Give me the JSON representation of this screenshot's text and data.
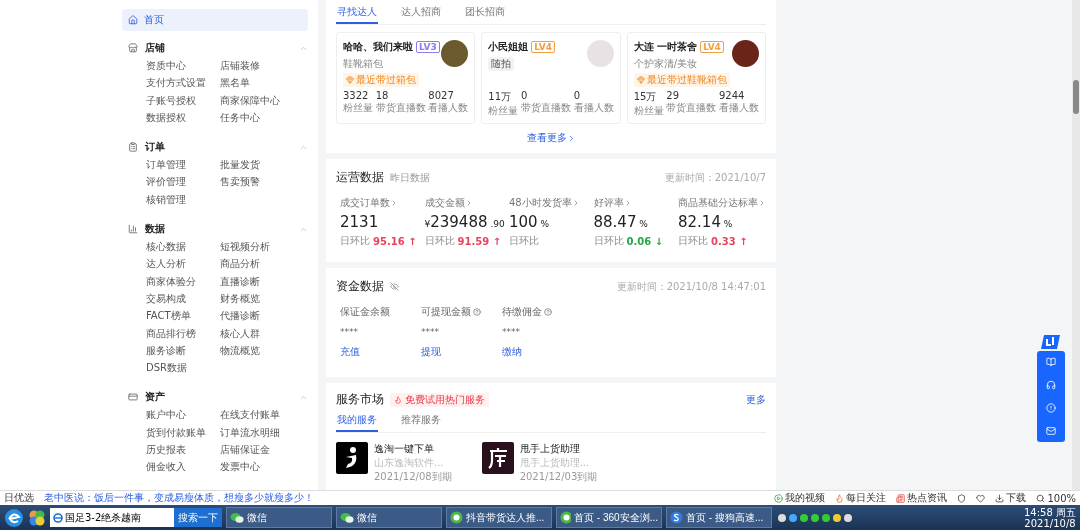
{
  "sidebar": {
    "home": {
      "label": "首页",
      "selected": true
    },
    "sections": [
      {
        "kind": "store",
        "title": "店铺",
        "expanded": true,
        "items": [
          "资质中心",
          "店铺装修",
          "支付方式设置",
          "黑名单",
          "子账号授权",
          "商家保障中心",
          "数据授权",
          "任务中心"
        ]
      },
      {
        "kind": "order",
        "title": "订单",
        "expanded": true,
        "items": [
          "订单管理",
          "批量发货",
          "评价管理",
          "售卖预警",
          "核销管理"
        ]
      },
      {
        "kind": "data",
        "title": "数据",
        "expanded": true,
        "items": [
          "核心数据",
          "短视频分析",
          "达人分析",
          "商品分析",
          "商家体验分",
          "直播诊断",
          "交易构成",
          "财务概览",
          "FACT榜单",
          "代播诊断",
          "商品排行榜",
          "核心人群",
          "服务诊断",
          "物流概览",
          "DSR数据"
        ]
      },
      {
        "kind": "asset",
        "title": "资产",
        "expanded": true,
        "items": [
          "账户中心",
          "在线支付账单",
          "货到付款账单",
          "订单流水明细",
          "历史报表",
          "店铺保证金",
          "佣金收入",
          "发票中心"
        ]
      }
    ]
  },
  "influencers": {
    "tabs": [
      {
        "label": "寻找达人",
        "selected": true
      },
      {
        "label": "达人招商",
        "selected": false
      },
      {
        "label": "团长招商",
        "selected": false
      }
    ],
    "cards": [
      {
        "name": "哈哈、我们来啦",
        "level": "LV3",
        "color": "#8a7df0",
        "category": "鞋靴箱包",
        "category_boxed": false,
        "badge": "最近带过箱包",
        "stats": [
          {
            "value": "3322",
            "label": "粉丝量"
          },
          {
            "value": "18",
            "label": "带货直播数"
          },
          {
            "value": "8027",
            "label": "看播人数"
          }
        ]
      },
      {
        "name": "小民姐姐",
        "level": "LV4",
        "color": "#f0a040",
        "category": "随拍",
        "category_boxed": true,
        "stats": [
          {
            "value": "11万",
            "label": "粉丝量"
          },
          {
            "value": "0",
            "label": "带货直播数"
          },
          {
            "value": "0",
            "label": "看播人数"
          }
        ]
      },
      {
        "name": "大连 一时茶舍",
        "level": "LV4",
        "color": "#f0a040",
        "category": "个护家清/美妆",
        "category_boxed": false,
        "badge": "最近带过鞋靴箱包",
        "stats": [
          {
            "value": "15万",
            "label": "粉丝量"
          },
          {
            "value": "29",
            "label": "带货直播数"
          },
          {
            "value": "9244",
            "label": "看播人数"
          }
        ]
      }
    ],
    "more": "查看更多"
  },
  "operations": {
    "title": "运营数据",
    "subtitle": "昨日数据",
    "updated": "更新时间：2021/10/7",
    "metrics": [
      {
        "label": "成交订单数",
        "value": "2131",
        "change_label": "日环比",
        "change": "95.16",
        "arrow": "↑",
        "color": "#e8455c"
      },
      {
        "label": "成交金额",
        "prefix": "¥",
        "value": "239488",
        "suffix": ".90",
        "change_label": "日环比",
        "change": "91.59",
        "arrow": "↑",
        "color": "#e8455c"
      },
      {
        "label": "48小时发货率",
        "value": "100",
        "suffix": "%",
        "change_label": "日环比"
      },
      {
        "label": "好评率",
        "value": "88.47",
        "suffix": "%",
        "change_label": "日环比",
        "change": "0.06",
        "arrow": "↓",
        "color": "#22a845"
      },
      {
        "label": "商品基础分达标率",
        "value": "82.14",
        "suffix": "%",
        "change_label": "日环比",
        "change": "0.33",
        "arrow": "↑",
        "color": "#e8455c"
      }
    ]
  },
  "funds": {
    "title": "资金数据",
    "updated": "更新时间：2021/10/8 14:47:01",
    "items": [
      {
        "label": "保证金余额",
        "help": false,
        "value": "****",
        "action": "充值"
      },
      {
        "label": "可提现金额",
        "help": true,
        "value": "****",
        "action": "提现"
      },
      {
        "label": "待缴佣金",
        "help": true,
        "value": "****",
        "action": "缴纳"
      }
    ]
  },
  "services": {
    "title": "服务市场",
    "promo": "免费试用热门服务",
    "more": "更多",
    "tabs": [
      {
        "label": "我的服务",
        "selected": true
      },
      {
        "label": "推荐服务",
        "selected": false
      }
    ],
    "items": [
      {
        "kind": "yitao",
        "name": "逸淘一键下单",
        "desc": "山东逸淘软件...",
        "expiry": "2021/12/08到期"
      },
      {
        "kind": "shop",
        "name": "甩手上货助理",
        "desc": "甩手上货助理...",
        "expiry": "2021/12/03到期"
      }
    ]
  },
  "status_bar": {
    "left": "日优选",
    "news": "老中医说：饭后一件事，变成易瘦体质，想瘦多少就瘦多少！",
    "links": [
      {
        "kind": "video",
        "label": "我的视频"
      },
      {
        "kind": "flame",
        "label": "每日关注"
      },
      {
        "kind": "news",
        "label": "热点资讯"
      }
    ],
    "download": "下载",
    "zoom": "100%"
  },
  "taskbar": {
    "search": "国足3-2绝杀越南",
    "search_button": "搜索一下",
    "windows": [
      {
        "kind": "wechat",
        "label": "微信"
      },
      {
        "kind": "wechat",
        "label": "微信"
      },
      {
        "kind": "browser360",
        "label": "抖音带货达人推..."
      },
      {
        "kind": "browser360",
        "label": "首页 - 360安全浏..."
      },
      {
        "kind": "sogou",
        "label": "首页 - 搜狗高速..."
      }
    ],
    "time": "14:58 周五",
    "date": "2021/10/8"
  }
}
